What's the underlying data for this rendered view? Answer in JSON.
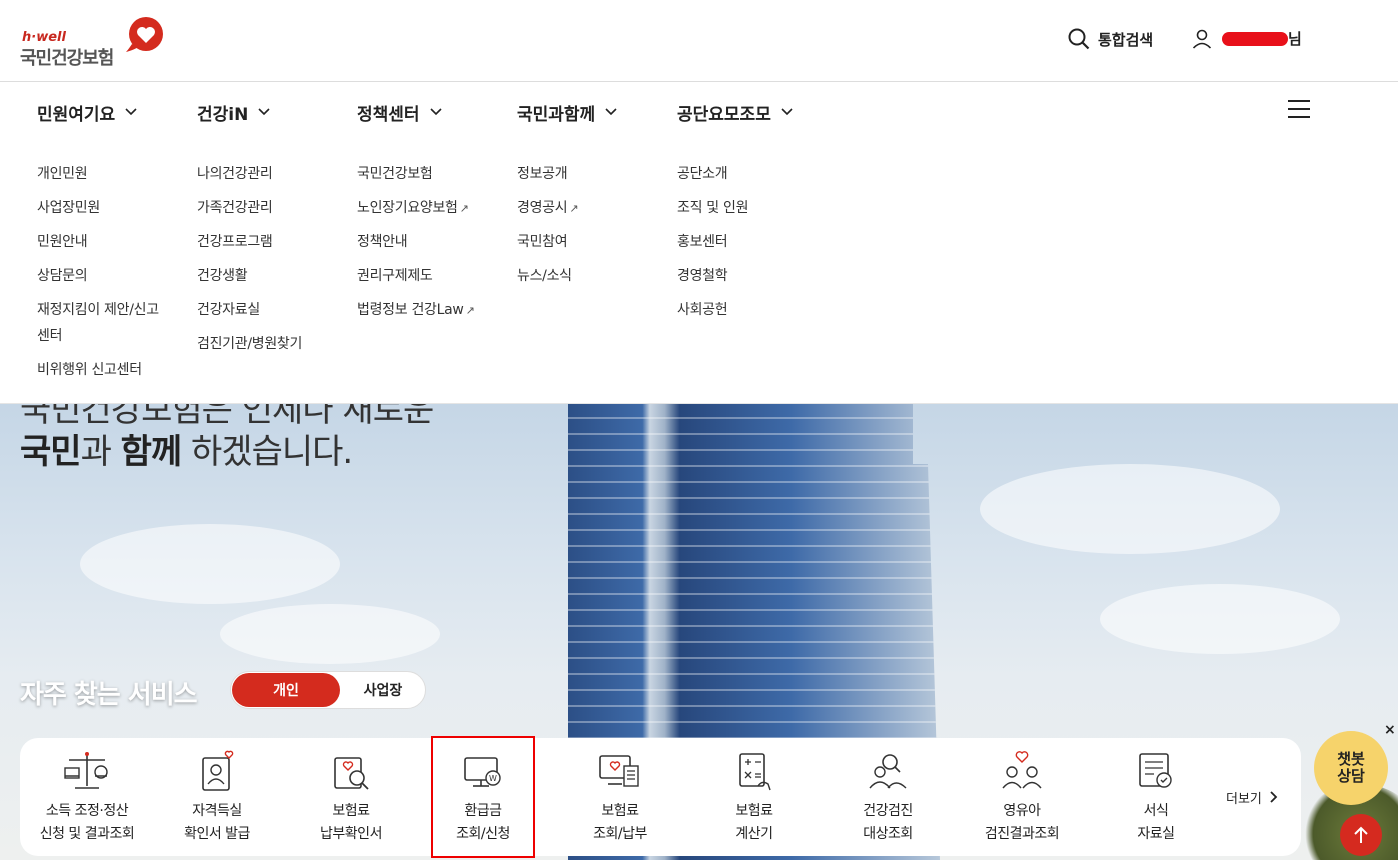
{
  "header": {
    "logo_sub": "h·well",
    "logo_name": "국민건강보험",
    "search_label": "통합검색",
    "user_suffix": "님"
  },
  "gnb": [
    {
      "label": "민원여기요",
      "chev": "⌄"
    },
    {
      "label": "건강iN",
      "chev": "⌄"
    },
    {
      "label": "정책센터",
      "chev": "⌄"
    },
    {
      "label": "국민과함께",
      "chev": "⌄"
    },
    {
      "label": "공단요모조모",
      "chev": "⌄"
    }
  ],
  "mega": {
    "col1": [
      "개인민원",
      "사업장민원",
      "민원안내",
      "상담문의",
      "재정지킴이 제안/신고",
      "센터",
      "비위행위 신고센터"
    ],
    "col2": [
      "나의건강관리",
      "가족건강관리",
      "건강프로그램",
      "건강생활",
      "건강자료실",
      "검진기관/병원찾기"
    ],
    "col3": [
      "국민건강보험",
      "노인장기요양보험",
      "정책안내",
      "권리구제제도",
      "법령정보 건강Law"
    ],
    "col4": [
      "정보공개",
      "경영공시",
      "국민참여",
      "뉴스/소식"
    ],
    "col5": [
      "공단소개",
      "조직 및 인원",
      "홍보센터",
      "경영철학",
      "사회공헌"
    ]
  },
  "hero": {
    "slogan_top": "국민건강보험은 언제나 새로운",
    "slogan_b1": "국민",
    "slogan_t1": "과 ",
    "slogan_b2": "함께",
    "slogan_t2": " 하겠습니다."
  },
  "services": {
    "title": "자주 찾는 서비스",
    "toggle_on": "개인",
    "toggle_off": "사업장",
    "items": [
      {
        "l1": "소득 조정·정산",
        "l2": "신청 및 결과조회",
        "icon": "scale-icon"
      },
      {
        "l1": "자격득실",
        "l2": "확인서 발급",
        "icon": "person-doc-icon"
      },
      {
        "l1": "보험료",
        "l2": "납부확인서",
        "icon": "search-doc-icon"
      },
      {
        "l1": "환급금",
        "l2": "조회/신청",
        "icon": "monitor-won-icon"
      },
      {
        "l1": "보험료",
        "l2": "조회/납부",
        "icon": "monitor-receipt-icon"
      },
      {
        "l1": "보험료",
        "l2": "계산기",
        "icon": "calculator-icon"
      },
      {
        "l1": "건강검진",
        "l2": "대상조회",
        "icon": "people-search-icon"
      },
      {
        "l1": "영유아",
        "l2": "검진결과조회",
        "icon": "family-icon"
      },
      {
        "l1": "서식",
        "l2": "자료실",
        "icon": "form-icon"
      }
    ],
    "more_label": "더보기"
  },
  "chatbot": {
    "l1": "챗봇",
    "l2": "상담"
  },
  "colors": {
    "brand_red": "#d42b1e",
    "highlight": "#ee0000"
  }
}
